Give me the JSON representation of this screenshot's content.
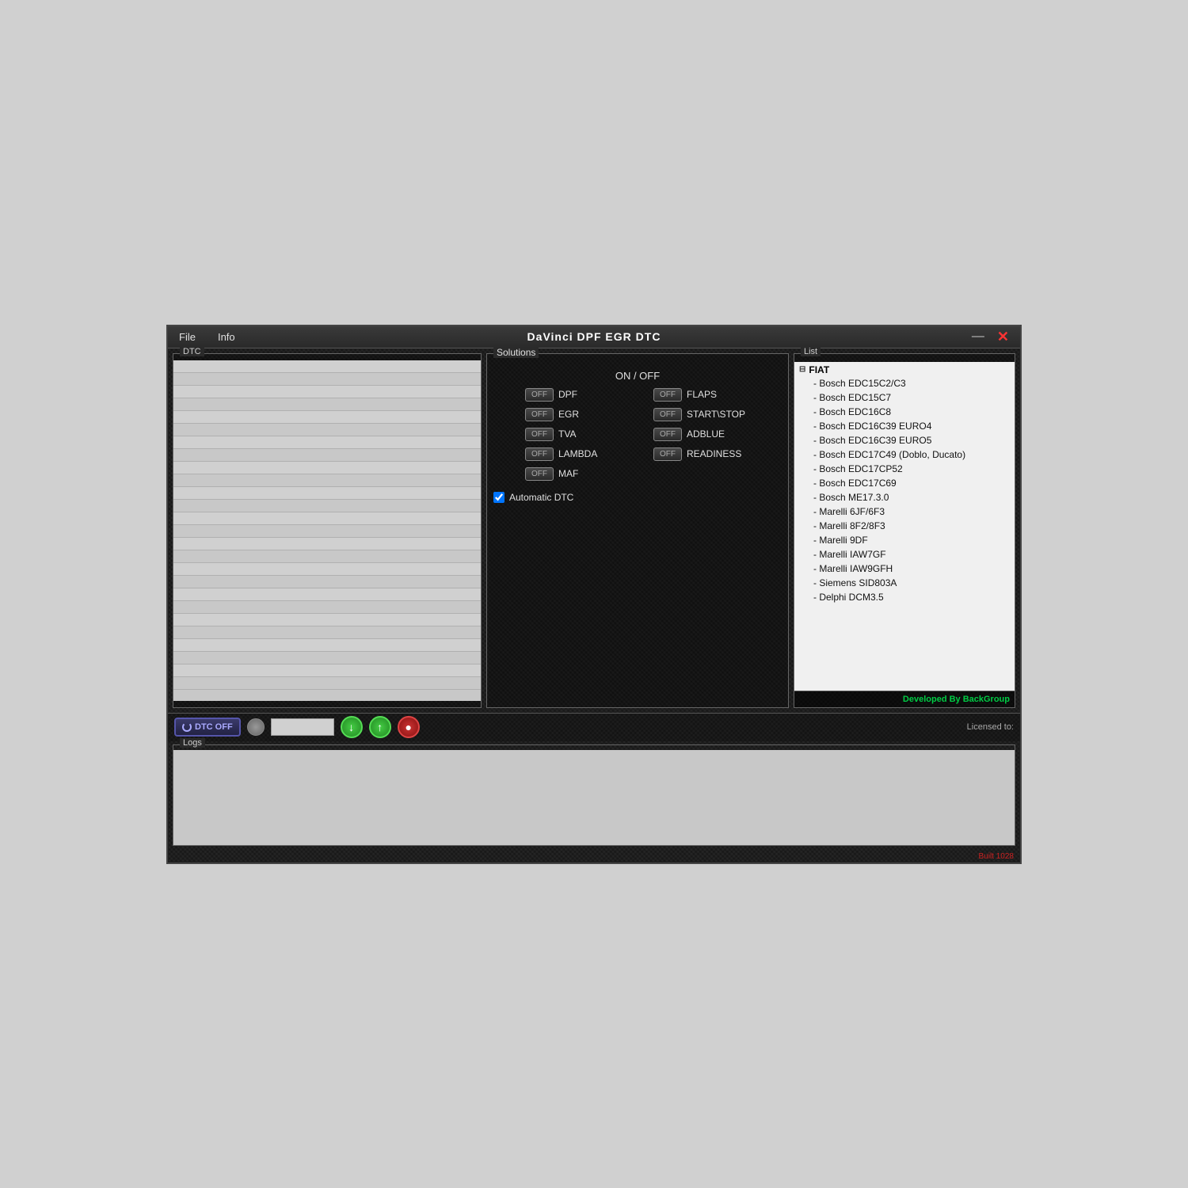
{
  "window": {
    "title": "DaVinci DPF EGR DTC",
    "menu": {
      "file": "File",
      "info": "Info"
    },
    "controls": {
      "minimize": "—",
      "close": "✕"
    }
  },
  "dtc_panel": {
    "label": "DTC",
    "rows": 28
  },
  "solutions_panel": {
    "label": "Solutions",
    "on_off_header": "ON  /  OFF",
    "left_items": [
      {
        "label": "DPF",
        "state": "OFF"
      },
      {
        "label": "EGR",
        "state": "OFF"
      },
      {
        "label": "TVA",
        "state": "OFF"
      },
      {
        "label": "LAMBDA",
        "state": "OFF"
      },
      {
        "label": "MAF",
        "state": "OFF"
      }
    ],
    "right_items": [
      {
        "label": "FLAPS",
        "state": "OFF"
      },
      {
        "label": "START\\STOP",
        "state": "OFF"
      },
      {
        "label": "ADBLUE",
        "state": "OFF"
      },
      {
        "label": "READINESS",
        "state": "OFF"
      }
    ],
    "auto_dtc_label": "Automatic DTC",
    "auto_dtc_checked": true
  },
  "list_panel": {
    "label": "List",
    "tree": {
      "group": "FIAT",
      "items": [
        "Bosch EDC15C2/C3",
        "Bosch EDC15C7",
        "Bosch EDC16C8",
        "Bosch EDC16C39 EURO4",
        "Bosch EDC16C39 EURO5",
        "Bosch EDC17C49  (Doblo, Ducato)",
        "Bosch EDC17CP52",
        "Bosch EDC17C69",
        "Bosch ME17.3.0",
        "Marelli 6JF/6F3",
        "Marelli 8F2/8F3",
        "Marelli 9DF",
        "Marelli IAW7GF",
        "Marelli IAW9GFH",
        "Siemens SID803A",
        "Delphi DCM3.5"
      ]
    },
    "developed_by": "Developed By BackGroup"
  },
  "toolbar": {
    "dtc_off_label": "DTC OFF",
    "licensed_to_label": "Licensed to:"
  },
  "logs_panel": {
    "label": "Logs"
  },
  "build": {
    "info": "Built 1028"
  }
}
